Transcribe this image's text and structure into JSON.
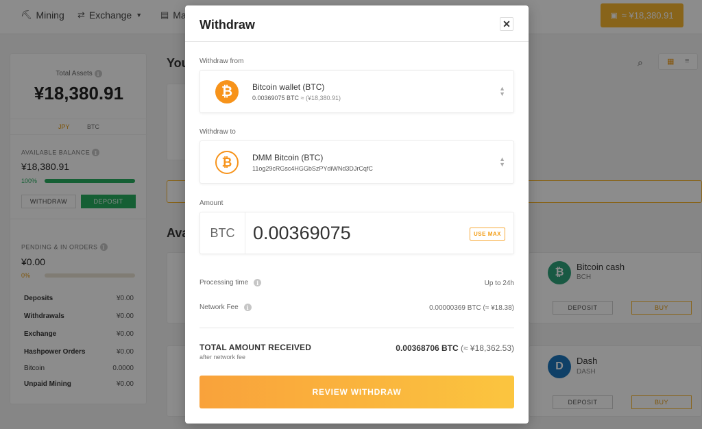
{
  "background": {
    "nav": [
      {
        "label": "Mining",
        "icon": "pickaxe-icon"
      },
      {
        "label": "Exchange",
        "icon": "exchange-icon"
      },
      {
        "label": "Ma",
        "icon": "market-icon"
      }
    ],
    "top_button_label": "≈ ¥18,380.91",
    "sidebar": {
      "total_assets_label": "Total Assets",
      "total_assets_value": "¥18,380.91",
      "currency_tabs": [
        "JPY",
        "BTC"
      ],
      "available_balance_label": "AVAILABLE BALANCE",
      "available_balance_value": "¥18,380.91",
      "available_progress_label": "100%",
      "available_progress": 1.0,
      "withdraw_label": "WITHDRAW",
      "deposit_label": "DEPOSIT",
      "pending_label": "PENDING & IN ORDERS",
      "pending_value": "¥0.00",
      "pending_progress_label": "0%",
      "pending_progress": 0.0,
      "rows": [
        {
          "label": "Deposits",
          "value": "¥0.00"
        },
        {
          "label": "Withdrawals",
          "value": "¥0.00"
        },
        {
          "label": "Exchange",
          "value": "¥0.00"
        },
        {
          "label": "Hashpower Orders",
          "value": "¥0.00"
        },
        {
          "label": "Bitcoin",
          "value": "0.0000"
        },
        {
          "label": "Unpaid Mining",
          "value": "¥0.00"
        }
      ]
    },
    "main_heading_partial": "You",
    "section_heading_partial": "Ava",
    "coins": [
      {
        "name": "Bitcoin cash",
        "ticker": "BCH",
        "color": "#2ea37a",
        "glyph": "₿",
        "deposit": "DEPOSIT",
        "buy": "BUY"
      },
      {
        "name": "Dash",
        "ticker": "DASH",
        "color": "#1c75bc",
        "glyph": "D",
        "deposit": "DEPOSIT",
        "buy": "BUY"
      }
    ]
  },
  "modal": {
    "title": "Withdraw",
    "close_icon": "close-icon",
    "withdraw_from": {
      "label": "Withdraw from",
      "title": "Bitcoin wallet (BTC)",
      "amount": "0.00369075 BTC",
      "approx": "≈ (¥18,380.91)"
    },
    "withdraw_to": {
      "label": "Withdraw to",
      "title": "DMM Bitcoin (BTC)",
      "address": "11og29cRGsc4HGGbSzPYdiWNd3DJrCqfC"
    },
    "amount": {
      "label": "Amount",
      "unit": "BTC",
      "value": "0.00369075",
      "use_max_label": "USE MAX"
    },
    "processing_time": {
      "label": "Processing time",
      "value": "Up to 24h"
    },
    "network_fee": {
      "label": "Network Fee",
      "value": "0.00000369 BTC (≈ ¥18.38)"
    },
    "total": {
      "label": "TOTAL AMOUNT RECEIVED",
      "sublabel": "after network fee",
      "value": "0.00368706 BTC",
      "approx": "(≈ ¥18,362.53)"
    },
    "review_button_label": "REVIEW WITHDRAW"
  },
  "colors": {
    "accent": "#f7b731",
    "bitcoin": "#f7931a",
    "success": "#27ae60"
  }
}
